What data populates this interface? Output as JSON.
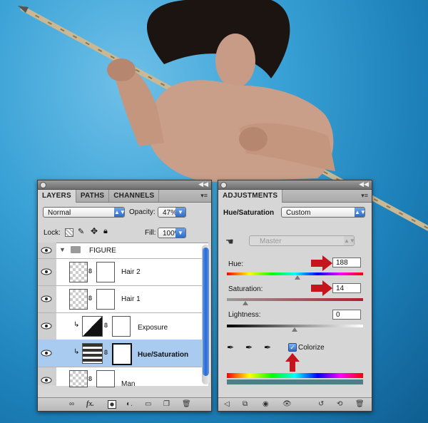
{
  "layers_panel": {
    "tabs": [
      "LAYERS",
      "PATHS",
      "CHANNELS"
    ],
    "blend_mode": "Normal",
    "opacity_label": "Opacity:",
    "opacity_value": "47%",
    "lock_label": "Lock:",
    "fill_label": "Fill:",
    "fill_value": "100%",
    "layers": [
      {
        "name": "FIGURE",
        "type": "group"
      },
      {
        "name": "Hair 2",
        "type": "layer"
      },
      {
        "name": "Hair 1",
        "type": "layer"
      },
      {
        "name": "Exposure",
        "type": "adjustment"
      },
      {
        "name": "Hue/Saturation",
        "type": "adjustment",
        "selected": true
      },
      {
        "name": "Man",
        "type": "layer"
      }
    ],
    "footer_icons": [
      "link-icon",
      "fx-icon",
      "mask-icon",
      "adjustment-icon",
      "folder-icon",
      "new-layer-icon",
      "trash-icon"
    ]
  },
  "adjustments_panel": {
    "tab": "ADJUSTMENTS",
    "title": "Hue/Saturation",
    "preset": "Custom",
    "channel": "Master",
    "hue_label": "Hue:",
    "hue_value": "188",
    "saturation_label": "Saturation:",
    "saturation_value": "14",
    "lightness_label": "Lightness:",
    "lightness_value": "0",
    "colorize_label": "Colorize",
    "colorize_checked": true,
    "hue_position": 0.52,
    "saturation_position": 0.14,
    "lightness_position": 0.5,
    "highlight_color": "#c4141c",
    "footer_icons": [
      "back-icon",
      "clip-icon",
      "visibility-icon",
      "eye-icon",
      "previous-state-icon",
      "reset-icon",
      "trash-icon"
    ]
  }
}
